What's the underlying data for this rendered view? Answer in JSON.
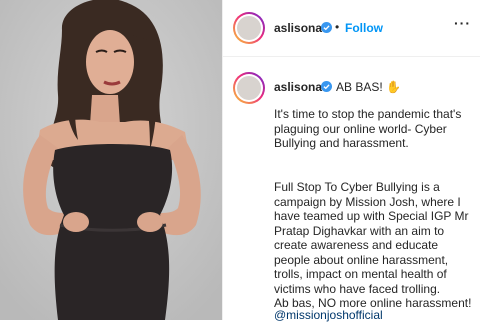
{
  "post": {
    "author": {
      "username": "aslisona",
      "verified": true
    },
    "header": {
      "separator": "•",
      "follow_label": "Follow",
      "more_label": "···"
    },
    "caption": {
      "headline": "AB BAS! ✋",
      "paragraph1": "It's time to stop the pandemic that's plaguing our online world- Cyber Bullying and harassment.",
      "paragraph2": "Full Stop To Cyber Bullying is a campaign by Mission Josh, where I have teamed up with Special IGP Mr Pratap Dighavkar with an aim to create awareness and educate people about online harassment, trolls, impact on mental health of victims who have faced trolling.",
      "paragraph3": "Ab bas, NO more online harassment!",
      "mention": "@missionjoshofficial"
    }
  },
  "colors": {
    "accent": "#0095f6",
    "verified": "#3897f0",
    "mention": "#00376b",
    "photo_background": "#c6c6c6",
    "dress": "#2a2526"
  }
}
